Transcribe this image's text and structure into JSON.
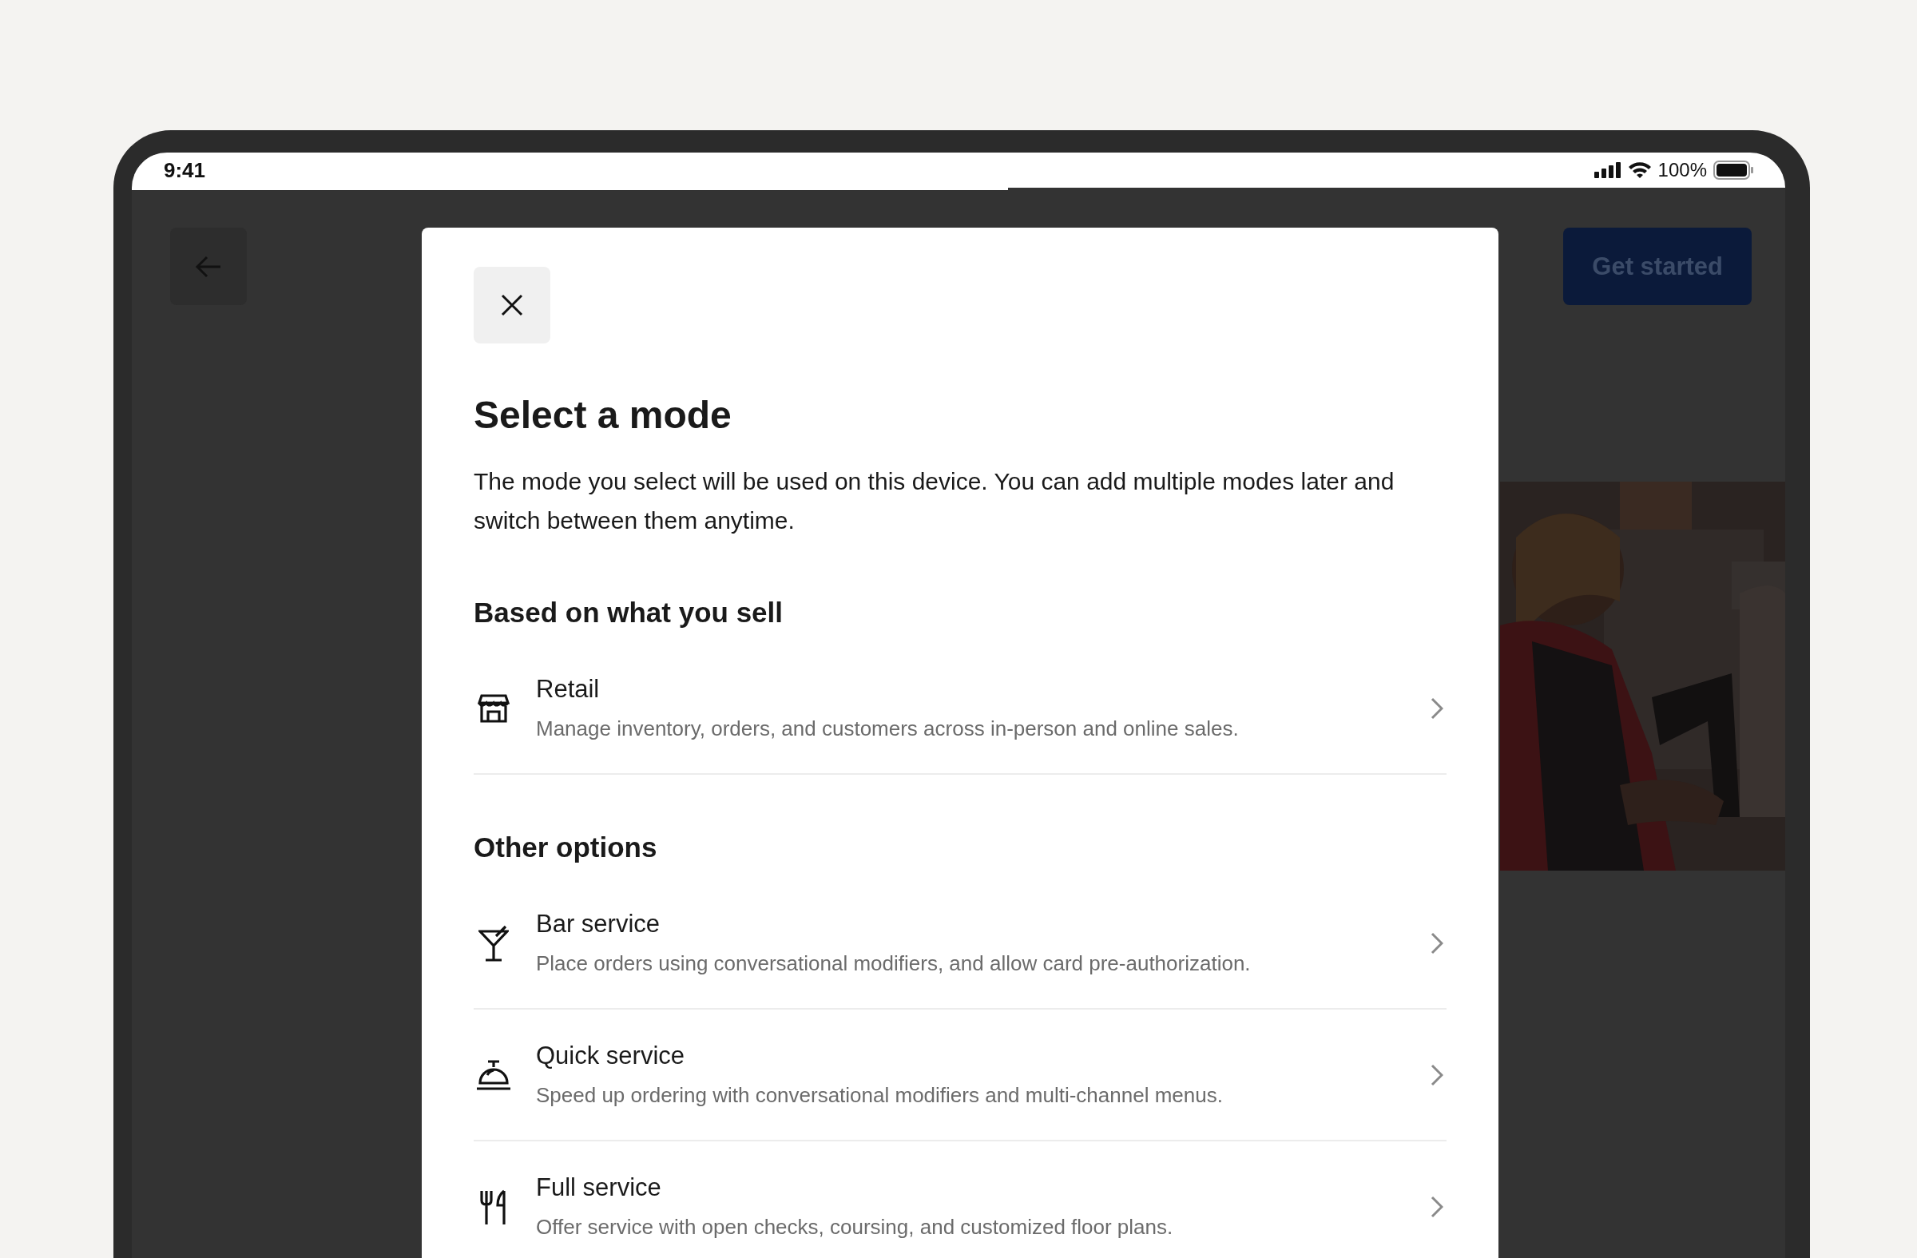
{
  "status_bar": {
    "time": "9:41",
    "battery": "100%"
  },
  "progress": {
    "level": 0.53
  },
  "header": {
    "action": "Get started"
  },
  "modal": {
    "title": "Select a mode",
    "description": "The mode you select will be used on this device. You can add multiple modes later and switch between them anytime.",
    "sections": [
      {
        "heading": "Based on what you sell",
        "options": [
          {
            "kind": "store",
            "title": "Retail",
            "description": "Manage inventory, orders, and customers across in-person and online sales."
          }
        ]
      },
      {
        "heading": "Other options",
        "options": [
          {
            "kind": "cocktail",
            "title": "Bar service",
            "description": "Place orders using conversational modifiers, and allow card pre-authorization."
          },
          {
            "kind": "bell",
            "title": "Quick service",
            "description": "Speed up ordering with conversational modifiers and multi-channel menus."
          },
          {
            "kind": "utensils",
            "title": "Full service",
            "description": "Offer service with open checks, coursing, and customized floor plans."
          }
        ]
      }
    ]
  }
}
